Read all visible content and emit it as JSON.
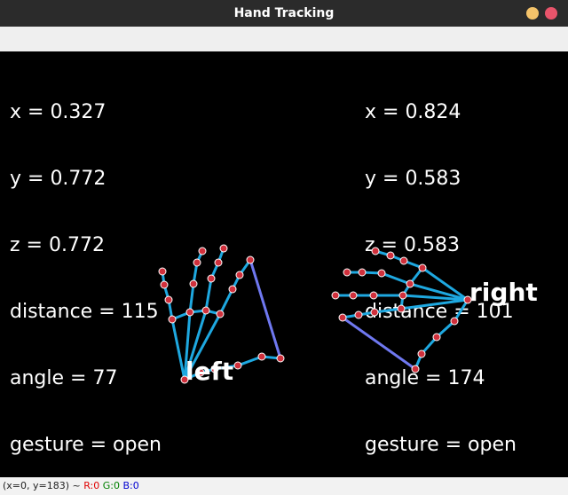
{
  "window": {
    "title": "Hand Tracking"
  },
  "left_readout": {
    "x": "x = 0.327",
    "y": "y = 0.772",
    "z": "z = 0.772",
    "distance": "distance = 115",
    "angle": "angle = 77",
    "gesture": "gesture = open"
  },
  "right_readout": {
    "x": "x = 0.824",
    "y": "y = 0.583",
    "z": "z = 0.583",
    "distance": "distance = 101",
    "angle": "angle = 174",
    "gesture": "gesture = open"
  },
  "hands": {
    "left_label": "left",
    "right_label": "right"
  },
  "status": {
    "coords": "(x=0, y=183) ~ ",
    "r": "R:0",
    "g": "G:0",
    "b": "B:0"
  },
  "colors": {
    "bone": "#1ea8e0",
    "palm_edge": "#6f78f0",
    "joint_fill": "#d0303c",
    "canvas": "#000000"
  }
}
